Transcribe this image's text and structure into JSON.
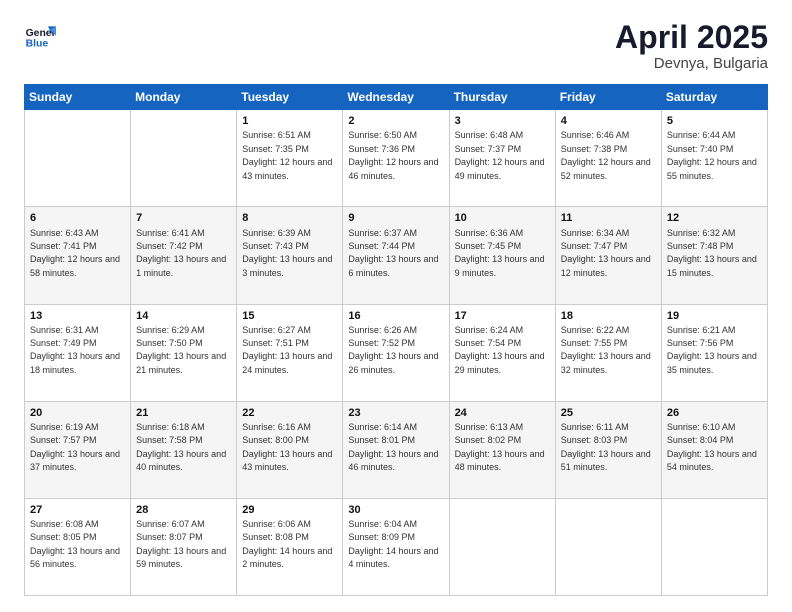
{
  "logo": {
    "line1": "General",
    "line2": "Blue"
  },
  "title": "April 2025",
  "location": "Devnya, Bulgaria",
  "days_header": [
    "Sunday",
    "Monday",
    "Tuesday",
    "Wednesday",
    "Thursday",
    "Friday",
    "Saturday"
  ],
  "weeks": [
    [
      {
        "day": "",
        "info": ""
      },
      {
        "day": "",
        "info": ""
      },
      {
        "day": "1",
        "info": "Sunrise: 6:51 AM\nSunset: 7:35 PM\nDaylight: 12 hours and 43 minutes."
      },
      {
        "day": "2",
        "info": "Sunrise: 6:50 AM\nSunset: 7:36 PM\nDaylight: 12 hours and 46 minutes."
      },
      {
        "day": "3",
        "info": "Sunrise: 6:48 AM\nSunset: 7:37 PM\nDaylight: 12 hours and 49 minutes."
      },
      {
        "day": "4",
        "info": "Sunrise: 6:46 AM\nSunset: 7:38 PM\nDaylight: 12 hours and 52 minutes."
      },
      {
        "day": "5",
        "info": "Sunrise: 6:44 AM\nSunset: 7:40 PM\nDaylight: 12 hours and 55 minutes."
      }
    ],
    [
      {
        "day": "6",
        "info": "Sunrise: 6:43 AM\nSunset: 7:41 PM\nDaylight: 12 hours and 58 minutes."
      },
      {
        "day": "7",
        "info": "Sunrise: 6:41 AM\nSunset: 7:42 PM\nDaylight: 13 hours and 1 minute."
      },
      {
        "day": "8",
        "info": "Sunrise: 6:39 AM\nSunset: 7:43 PM\nDaylight: 13 hours and 3 minutes."
      },
      {
        "day": "9",
        "info": "Sunrise: 6:37 AM\nSunset: 7:44 PM\nDaylight: 13 hours and 6 minutes."
      },
      {
        "day": "10",
        "info": "Sunrise: 6:36 AM\nSunset: 7:45 PM\nDaylight: 13 hours and 9 minutes."
      },
      {
        "day": "11",
        "info": "Sunrise: 6:34 AM\nSunset: 7:47 PM\nDaylight: 13 hours and 12 minutes."
      },
      {
        "day": "12",
        "info": "Sunrise: 6:32 AM\nSunset: 7:48 PM\nDaylight: 13 hours and 15 minutes."
      }
    ],
    [
      {
        "day": "13",
        "info": "Sunrise: 6:31 AM\nSunset: 7:49 PM\nDaylight: 13 hours and 18 minutes."
      },
      {
        "day": "14",
        "info": "Sunrise: 6:29 AM\nSunset: 7:50 PM\nDaylight: 13 hours and 21 minutes."
      },
      {
        "day": "15",
        "info": "Sunrise: 6:27 AM\nSunset: 7:51 PM\nDaylight: 13 hours and 24 minutes."
      },
      {
        "day": "16",
        "info": "Sunrise: 6:26 AM\nSunset: 7:52 PM\nDaylight: 13 hours and 26 minutes."
      },
      {
        "day": "17",
        "info": "Sunrise: 6:24 AM\nSunset: 7:54 PM\nDaylight: 13 hours and 29 minutes."
      },
      {
        "day": "18",
        "info": "Sunrise: 6:22 AM\nSunset: 7:55 PM\nDaylight: 13 hours and 32 minutes."
      },
      {
        "day": "19",
        "info": "Sunrise: 6:21 AM\nSunset: 7:56 PM\nDaylight: 13 hours and 35 minutes."
      }
    ],
    [
      {
        "day": "20",
        "info": "Sunrise: 6:19 AM\nSunset: 7:57 PM\nDaylight: 13 hours and 37 minutes."
      },
      {
        "day": "21",
        "info": "Sunrise: 6:18 AM\nSunset: 7:58 PM\nDaylight: 13 hours and 40 minutes."
      },
      {
        "day": "22",
        "info": "Sunrise: 6:16 AM\nSunset: 8:00 PM\nDaylight: 13 hours and 43 minutes."
      },
      {
        "day": "23",
        "info": "Sunrise: 6:14 AM\nSunset: 8:01 PM\nDaylight: 13 hours and 46 minutes."
      },
      {
        "day": "24",
        "info": "Sunrise: 6:13 AM\nSunset: 8:02 PM\nDaylight: 13 hours and 48 minutes."
      },
      {
        "day": "25",
        "info": "Sunrise: 6:11 AM\nSunset: 8:03 PM\nDaylight: 13 hours and 51 minutes."
      },
      {
        "day": "26",
        "info": "Sunrise: 6:10 AM\nSunset: 8:04 PM\nDaylight: 13 hours and 54 minutes."
      }
    ],
    [
      {
        "day": "27",
        "info": "Sunrise: 6:08 AM\nSunset: 8:05 PM\nDaylight: 13 hours and 56 minutes."
      },
      {
        "day": "28",
        "info": "Sunrise: 6:07 AM\nSunset: 8:07 PM\nDaylight: 13 hours and 59 minutes."
      },
      {
        "day": "29",
        "info": "Sunrise: 6:06 AM\nSunset: 8:08 PM\nDaylight: 14 hours and 2 minutes."
      },
      {
        "day": "30",
        "info": "Sunrise: 6:04 AM\nSunset: 8:09 PM\nDaylight: 14 hours and 4 minutes."
      },
      {
        "day": "",
        "info": ""
      },
      {
        "day": "",
        "info": ""
      },
      {
        "day": "",
        "info": ""
      }
    ]
  ]
}
